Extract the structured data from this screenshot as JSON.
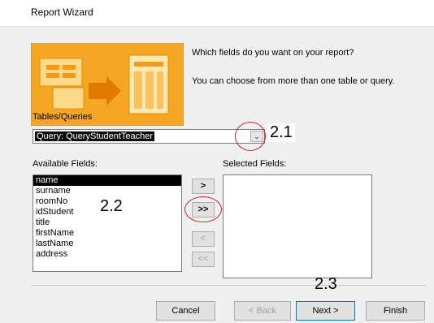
{
  "window": {
    "title": "Report Wizard"
  },
  "prompts": {
    "question": "Which fields do you want on your report?",
    "hint": "You can choose from more than one table or query."
  },
  "tables_queries": {
    "label": "Tables/Queries",
    "selected": "Query: QueryStudentTeacher"
  },
  "available_fields": {
    "label": "Available Fields:",
    "items": [
      "name",
      "surname",
      "roomNo",
      "idStudent",
      "title",
      "firstName",
      "lastName",
      "address"
    ],
    "selected_index": 0
  },
  "selected_fields": {
    "label": "Selected Fields:",
    "items": []
  },
  "move_buttons": {
    "add_one": ">",
    "add_all": ">>",
    "remove_one": "<",
    "remove_all": "<<"
  },
  "buttons": {
    "cancel": "Cancel",
    "back": "< Back",
    "next": "Next >",
    "finish": "Finish"
  },
  "annotations": {
    "combo": "2.1",
    "add_all": "2.2",
    "next": "2.3"
  },
  "colors": {
    "banner": "#f5a623",
    "annotation_circle": "#d42020"
  }
}
